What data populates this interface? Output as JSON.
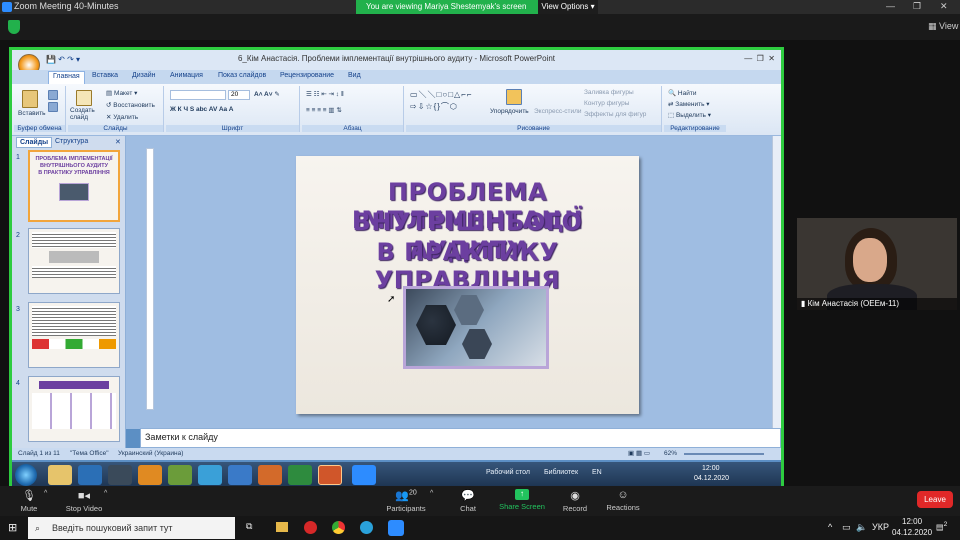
{
  "zoom": {
    "window_title": "Zoom Meeting 40-Minutes",
    "share_banner": "You are viewing Mariya Shestemyak's screen",
    "view_options": "View Options",
    "view_label": "View",
    "participant_name": "Кім Анастасія (ОЕЕм-11)",
    "participant_count": "20",
    "controls": [
      {
        "label": "Mute"
      },
      {
        "label": "Stop Video"
      },
      {
        "label": "Participants"
      },
      {
        "label": "Chat"
      },
      {
        "label": "Share Screen"
      },
      {
        "label": "Record"
      },
      {
        "label": "Reactions"
      }
    ],
    "leave": "Leave"
  },
  "ppt": {
    "title": "6_Кім Анастасія. Проблеми імплементації внутрішнього аудиту - Microsoft PowerPoint",
    "tabs": [
      "Главная",
      "Вставка",
      "Дизайн",
      "Анимация",
      "Показ слайдов",
      "Рецензирование",
      "Вид"
    ],
    "groups": {
      "clipboard": "Буфер обмена",
      "slides": "Слайды",
      "font": "Шрифт",
      "paragraph": "Абзац",
      "drawing": "Рисование",
      "editing": "Редактирование"
    },
    "ribbon": {
      "paste": "Вставить",
      "new_slide": "Создать слайд",
      "layout": "Макет",
      "reset": "Восстановить",
      "delete": "Удалить",
      "font_size": "20",
      "arrange": "Упорядочить",
      "quick_styles": "Экспресс-стили",
      "shape_fill": "Заливка фигуры",
      "shape_outline": "Контур фигуры",
      "shape_effects": "Эффекты для фигур",
      "find": "Найти",
      "replace": "Заменить",
      "select": "Выделить"
    },
    "pane_tabs": [
      "Слайды",
      "Структура"
    ],
    "slide_numbers": [
      "1",
      "2",
      "3",
      "4"
    ],
    "slide": {
      "title_lines": [
        "ПРОБЛЕМА ІМПЛЕМЕНТАЦІЇ",
        "ВНУТРІШНЬОГО АУДИТУ",
        "В ПРАКТИКУ УПРАВЛІННЯ"
      ]
    },
    "notes_placeholder": "Заметки к слайду",
    "status": {
      "slide_count": "Слайд 1 из 11",
      "theme": "\"Тема Office\"",
      "language": "Украинский (Украина)",
      "zoom": "62%"
    },
    "win7_tray": {
      "desktop": "Рабочий стол",
      "library": "Библиотек",
      "lang": "EN",
      "time": "12:00",
      "date": "04.12.2020"
    }
  },
  "windows": {
    "search_placeholder": "Введіть пошуковий запит тут",
    "lang": "УКР",
    "time": "12:00",
    "date": "04.12.2020",
    "notif_count": "2"
  }
}
